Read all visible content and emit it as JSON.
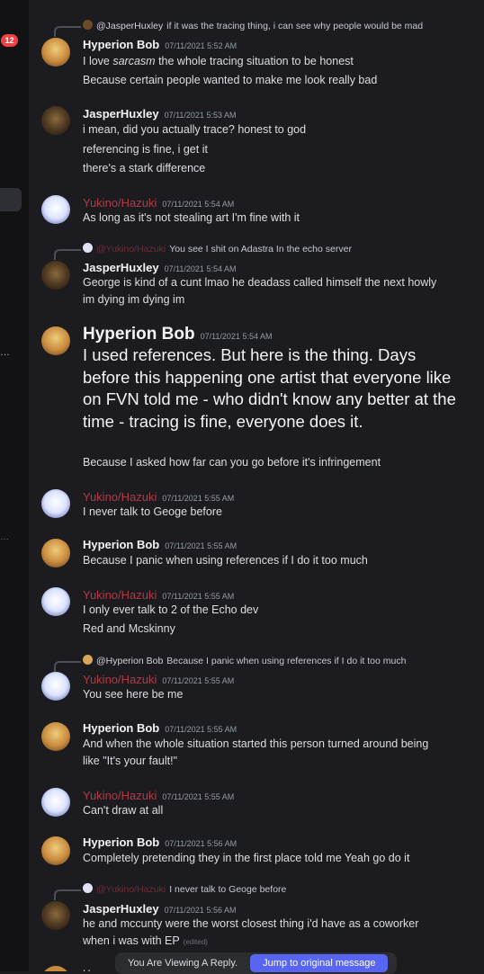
{
  "server_rail": {
    "badge": "12"
  },
  "messages": [
    {
      "reply": {
        "author": "@JasperHuxley",
        "text": "if it was the tracing thing, i can see why people would be mad"
      },
      "author": "Hyperion Bob",
      "timestamp": "07/11/2021 5:52 AM",
      "line1_before": "I love ",
      "line1_em": "sarcasm",
      "line1_after": " the whole tracing situation to be honest",
      "line2": "Because certain people wanted to make me look really bad"
    },
    {
      "author": "JasperHuxley",
      "timestamp": "07/11/2021 5:53 AM",
      "lines": [
        "i mean, did you actually trace? honest to god",
        "referencing is fine, i get it",
        "there's a stark difference"
      ]
    },
    {
      "author": "Yukino/Hazuki",
      "timestamp": "07/11/2021 5:54 AM",
      "lines": [
        "As long as it's not stealing art I'm fine with it"
      ]
    },
    {
      "reply": {
        "author": "@Yukino/Hazuki",
        "text": "You see I shit on Adastra In the echo server"
      },
      "author": "JasperHuxley",
      "timestamp": "07/11/2021 5:54 AM",
      "lines": [
        "George is kind of a cunt lmao he deadass called himself the next howly",
        "im dying im dying im"
      ]
    },
    {
      "author": "Hyperion Bob",
      "timestamp": "07/11/2021 5:54 AM",
      "big_text": "I used references. But here is the thing. Days before this happening one artist that everyone like on FVN told me - who didn't know any better at the time - tracing is fine, everyone does it.",
      "lines": [
        "Because I asked how far can you go before it's infringement"
      ]
    },
    {
      "author": "Yukino/Hazuki",
      "timestamp": "07/11/2021 5:55 AM",
      "lines": [
        "I never talk to Geoge before"
      ]
    },
    {
      "author": "Hyperion Bob",
      "timestamp": "07/11/2021 5:55 AM",
      "lines": [
        "Because I panic when using references if I do it too much"
      ]
    },
    {
      "author": "Yukino/Hazuki",
      "timestamp": "07/11/2021 5:55 AM",
      "lines": [
        "I only ever talk to 2 of the Echo dev",
        "Red and Mcskinny"
      ]
    },
    {
      "reply": {
        "author": "@Hyperion Bob",
        "text": "Because I panic when using references if I do it too much"
      },
      "author": "Yukino/Hazuki",
      "timestamp": "07/11/2021 5:55 AM",
      "lines": [
        "You see here be me"
      ]
    },
    {
      "author": "Hyperion Bob",
      "timestamp": "07/11/2021 5:55 AM",
      "lines": [
        "And when the whole situation started this person turned around being",
        "like \"It's your fault!\""
      ]
    },
    {
      "author": "Yukino/Hazuki",
      "timestamp": "07/11/2021 5:55 AM",
      "lines": [
        "Can't draw at all"
      ]
    },
    {
      "author": "Hyperion Bob",
      "timestamp": "07/11/2021 5:56 AM",
      "lines": [
        "Completely pretending they in the first place told me Yeah go do it"
      ]
    },
    {
      "reply": {
        "author": "@Yukino/Hazuki",
        "text": "I never talk to Geoge before"
      },
      "author": "JasperHuxley",
      "timestamp": "07/11/2021 5:56 AM",
      "lines": [
        "he and mccunty were the worst closest thing i'd have as a coworker",
        "when i was with EP"
      ],
      "edited": "(edited)"
    }
  ],
  "bottom_partial": "H",
  "reply_bar": {
    "label": "You Are Viewing A Reply.",
    "button": "Jump to original message"
  }
}
